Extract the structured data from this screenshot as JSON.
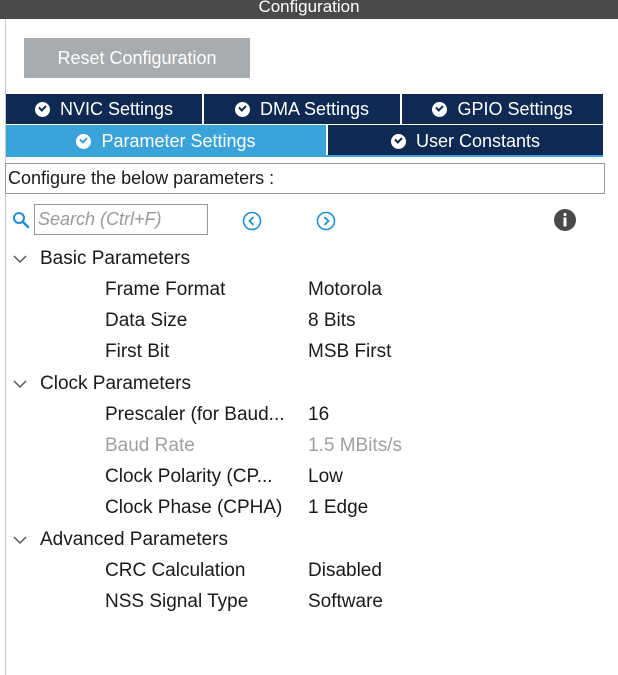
{
  "window": {
    "title": "Configuration"
  },
  "reset_button": "Reset Configuration",
  "tabs_row1": [
    {
      "label": "NVIC Settings"
    },
    {
      "label": "DMA Settings"
    },
    {
      "label": "GPIO Settings"
    }
  ],
  "tabs_row2": [
    {
      "label": "Parameter Settings",
      "active": true
    },
    {
      "label": "User Constants"
    }
  ],
  "description": "Configure the below parameters :",
  "search": {
    "placeholder": "Search (Ctrl+F)",
    "value": ""
  },
  "icons": {
    "search": "search-icon",
    "prev": "circle-chevron-left-icon",
    "next": "circle-chevron-right-icon",
    "info": "info-icon",
    "collapse": "chevron-down-icon",
    "check": "check-circle-icon"
  },
  "groups": [
    {
      "title": "Basic Parameters",
      "params": [
        {
          "name": "Frame Format",
          "value": "Motorola"
        },
        {
          "name": "Data Size",
          "value": "8 Bits"
        },
        {
          "name": "First Bit",
          "value": "MSB First"
        }
      ]
    },
    {
      "title": "Clock Parameters",
      "params": [
        {
          "name": "Prescaler (for Baud...",
          "value": "16"
        },
        {
          "name": "Baud Rate",
          "value": "1.5 MBits/s",
          "disabled": true
        },
        {
          "name": "Clock Polarity (CP...",
          "value": "Low"
        },
        {
          "name": "Clock Phase (CPHA)",
          "value": "1 Edge"
        }
      ]
    },
    {
      "title": "Advanced Parameters",
      "params": [
        {
          "name": "CRC Calculation",
          "value": "Disabled"
        },
        {
          "name": "NSS Signal Type",
          "value": "Software"
        }
      ]
    }
  ],
  "colors": {
    "titlebar": "#4a4a4a",
    "tab_inactive": "#0e2a52",
    "tab_active": "#3aa3d9",
    "button_bg": "#a9acae",
    "disabled_text": "#a0a0a0"
  }
}
